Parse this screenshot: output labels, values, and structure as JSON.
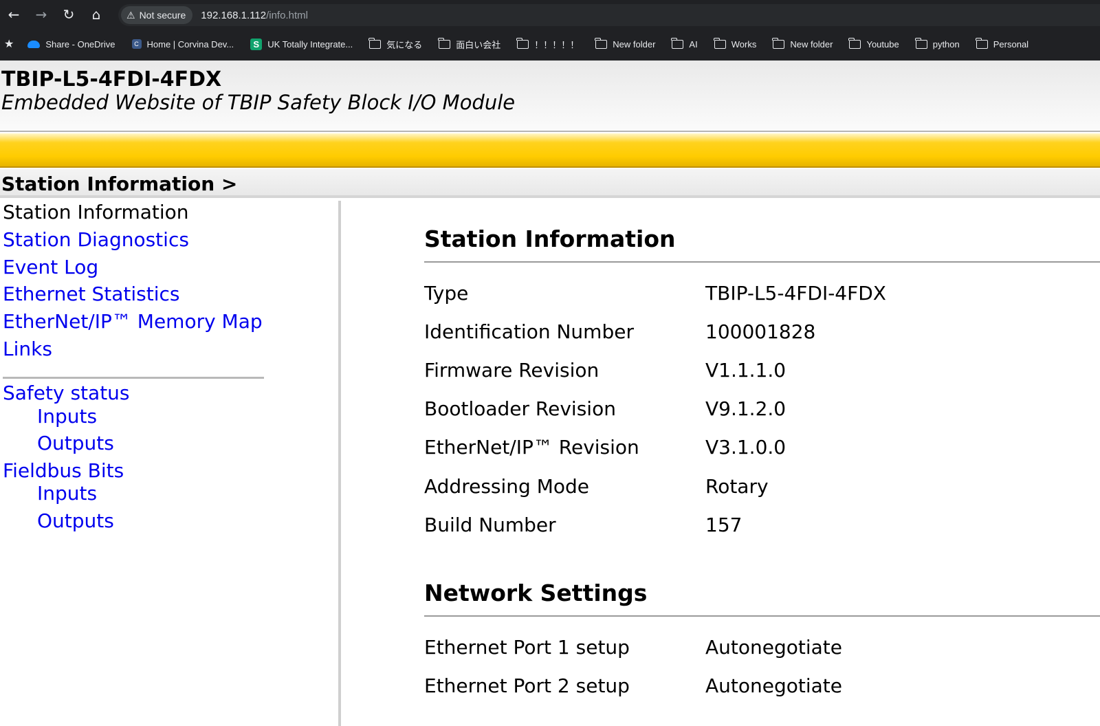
{
  "browser": {
    "security_label": "Not secure",
    "url_host": "192.168.1.112",
    "url_path": "/info.html",
    "bookmarks": [
      {
        "label": "Share - OneDrive",
        "icon": "onedrive-icon"
      },
      {
        "label": "Home | Corvina Dev...",
        "icon": "corvina-icon"
      },
      {
        "label": "UK Totally Integrate...",
        "icon": "s-icon"
      },
      {
        "label": "気になる",
        "icon": "folder-icon"
      },
      {
        "label": "面白い会社",
        "icon": "folder-icon"
      },
      {
        "label": "！！！！！",
        "icon": "folder-icon"
      },
      {
        "label": "New folder",
        "icon": "folder-icon"
      },
      {
        "label": "AI",
        "icon": "folder-icon"
      },
      {
        "label": "Works",
        "icon": "folder-icon"
      },
      {
        "label": "New folder",
        "icon": "folder-icon"
      },
      {
        "label": "Youtube",
        "icon": "folder-icon"
      },
      {
        "label": "python",
        "icon": "folder-icon"
      },
      {
        "label": "Personal",
        "icon": "folder-icon"
      }
    ]
  },
  "header": {
    "title": "TBIP-L5-4FDI-4FDX",
    "subtitle": "Embedded Website of TBIP Safety Block I/O Module"
  },
  "breadcrumb": "Station Information >",
  "sidebar": {
    "links": [
      {
        "label": "Station Information",
        "current": true
      },
      {
        "label": "Station Diagnostics"
      },
      {
        "label": "Event Log"
      },
      {
        "label": "Ethernet Statistics"
      },
      {
        "label": "EtherNet/IP™ Memory Map"
      },
      {
        "label": "Links"
      }
    ],
    "safety_status": {
      "label": "Safety status",
      "inputs": "Inputs",
      "outputs": "Outputs"
    },
    "fieldbus_bits": {
      "label": "Fieldbus Bits",
      "inputs": "Inputs",
      "outputs": "Outputs"
    }
  },
  "station_information": {
    "title": "Station Information",
    "rows": [
      {
        "label": "Type",
        "value": "TBIP-L5-4FDI-4FDX"
      },
      {
        "label": "Identification Number",
        "value": "100001828"
      },
      {
        "label": "Firmware Revision",
        "value": "V1.1.1.0"
      },
      {
        "label": "Bootloader Revision",
        "value": "V9.1.2.0"
      },
      {
        "label": "EtherNet/IP™ Revision",
        "value": "V3.1.0.0"
      },
      {
        "label": "Addressing Mode",
        "value": "Rotary"
      },
      {
        "label": "Build Number",
        "value": "157"
      }
    ]
  },
  "network_settings": {
    "title": "Network Settings",
    "rows": [
      {
        "label": "Ethernet Port 1 setup",
        "value": "Autonegotiate"
      },
      {
        "label": "Ethernet Port 2 setup",
        "value": "Autonegotiate"
      }
    ]
  },
  "colors": {
    "accent_yellow": "#ffcc00",
    "link": "#0000ee"
  }
}
